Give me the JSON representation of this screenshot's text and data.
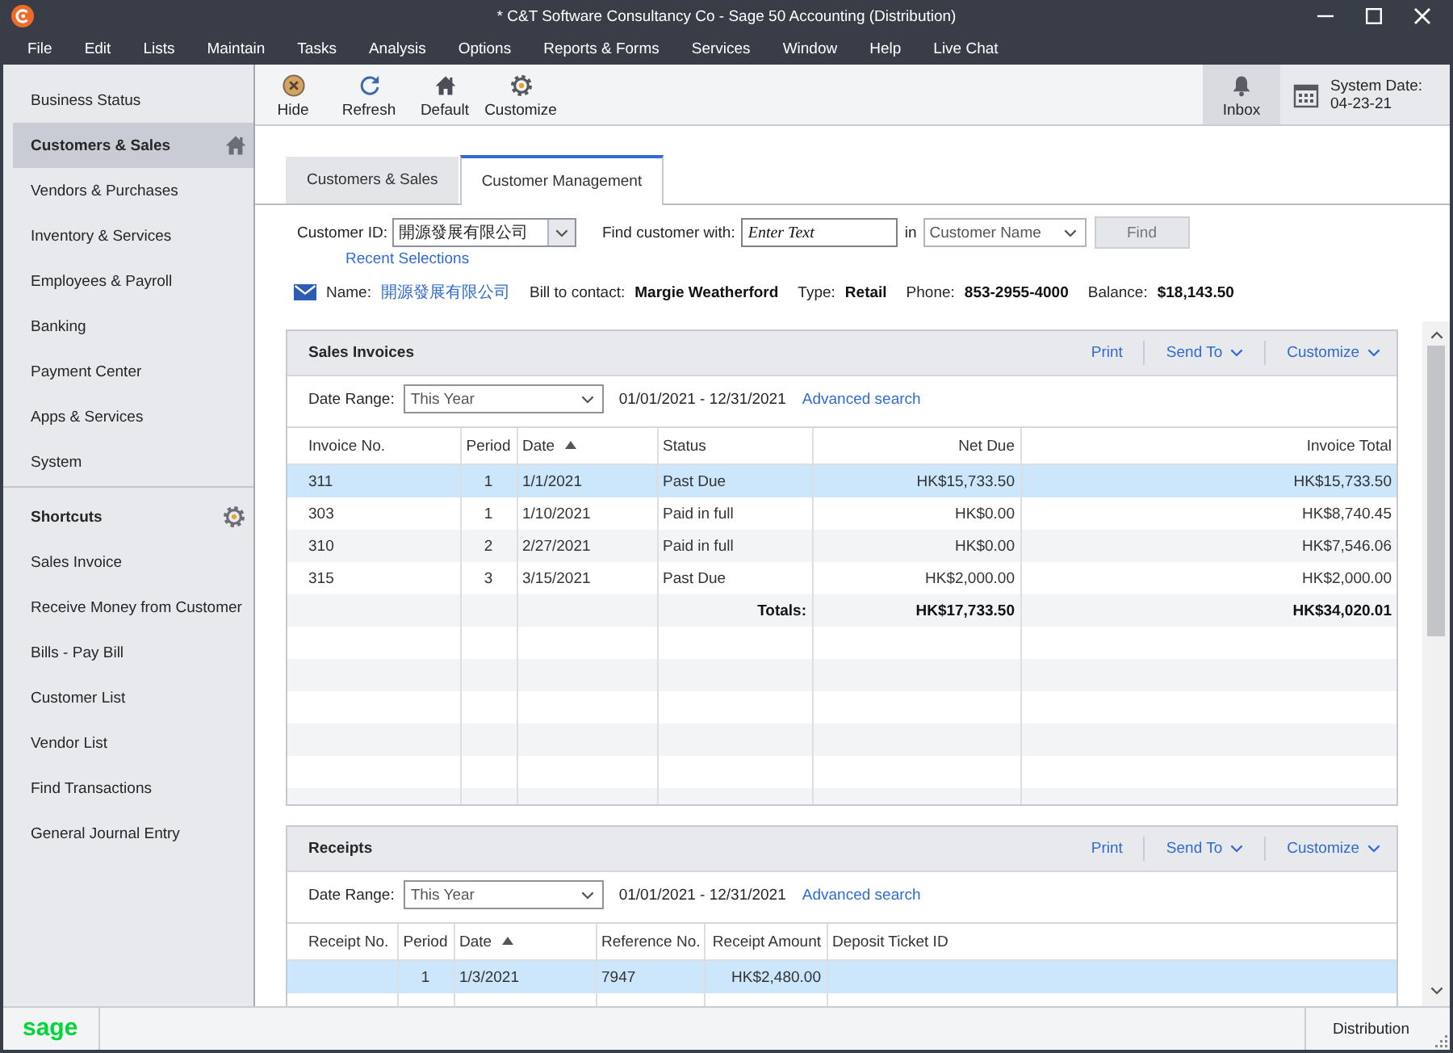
{
  "window": {
    "title": "* C&T Software Consultancy Co - Sage 50 Accounting (Distribution)"
  },
  "menu": [
    "File",
    "Edit",
    "Lists",
    "Maintain",
    "Tasks",
    "Analysis",
    "Options",
    "Reports & Forms",
    "Services",
    "Window",
    "Help",
    "Live Chat"
  ],
  "sidebar": {
    "nav": [
      {
        "label": "Business Status",
        "selected": false
      },
      {
        "label": "Customers & Sales",
        "selected": true
      },
      {
        "label": "Vendors & Purchases",
        "selected": false
      },
      {
        "label": "Inventory & Services",
        "selected": false
      },
      {
        "label": "Employees & Payroll",
        "selected": false
      },
      {
        "label": "Banking",
        "selected": false
      },
      {
        "label": "Payment Center",
        "selected": false
      },
      {
        "label": "Apps & Services",
        "selected": false
      },
      {
        "label": "System",
        "selected": false
      }
    ],
    "shortcuts_title": "Shortcuts",
    "shortcuts": [
      "Sales Invoice",
      "Receive Money from Customer",
      "Bills - Pay Bill",
      "Customer List",
      "Vendor List",
      "Find Transactions",
      "General Journal Entry"
    ]
  },
  "toolbar": {
    "buttons": [
      {
        "label": "Hide",
        "kind": "hide"
      },
      {
        "label": "Refresh",
        "kind": "refresh"
      },
      {
        "label": "Default",
        "kind": "default"
      },
      {
        "label": "Customize",
        "kind": "customize"
      }
    ],
    "inbox": "Inbox",
    "system_date_label": "System Date:",
    "system_date": "04-23-21"
  },
  "tabs": [
    {
      "label": "Customers & Sales",
      "selected": false
    },
    {
      "label": "Customer Management",
      "selected": true
    }
  ],
  "customer_search": {
    "id_label": "Customer ID:",
    "id_value": "開源發展有限公司",
    "recent_link": "Recent Selections",
    "find_label": "Find customer with:",
    "find_placeholder": "Enter Text",
    "in_label": "in",
    "field": "Customer Name",
    "find_button": {
      "label": "Find",
      "disabled": true
    }
  },
  "customer_info": [
    {
      "label": "Name:",
      "value": "開源發展有限公司",
      "kind": "link"
    },
    {
      "label": "Bill to contact:",
      "value": "Margie Weatherford",
      "kind": "bold"
    },
    {
      "label": "Type:",
      "value": "Retail",
      "kind": "bold"
    },
    {
      "label": "Phone:",
      "value": "853-2955-4000",
      "kind": "bold"
    },
    {
      "label": "Balance:",
      "value": "$18,143.50",
      "kind": "bold"
    }
  ],
  "sales_invoices": {
    "title": "Sales Invoices",
    "actions": [
      {
        "label": "Print",
        "dropdown": false
      },
      {
        "label": "Send To",
        "dropdown": true
      },
      {
        "label": "Customize",
        "dropdown": true
      }
    ],
    "date_range_label": "Date Range:",
    "date_range": "This Year",
    "date_span": "01/01/2021 - 12/31/2021",
    "advanced_link": "Advanced search",
    "columns": [
      {
        "label": "Invoice No.",
        "sorted": false
      },
      {
        "label": "Period",
        "sorted": false
      },
      {
        "label": "Date",
        "sorted": true
      },
      {
        "label": "Status",
        "sorted": false
      },
      {
        "label": "Net Due",
        "sorted": false
      },
      {
        "label": "Invoice Total",
        "sorted": false
      }
    ],
    "rows": [
      {
        "invoice_no": "311",
        "period": "1",
        "date": "1/1/2021",
        "status": "Past Due",
        "net_due": "HK$15,733.50",
        "invoice_total": "HK$15,733.50",
        "selected": true
      },
      {
        "invoice_no": "303",
        "period": "1",
        "date": "1/10/2021",
        "status": "Paid in full",
        "net_due": "HK$0.00",
        "invoice_total": "HK$8,740.45",
        "selected": false
      },
      {
        "invoice_no": "310",
        "period": "2",
        "date": "2/27/2021",
        "status": "Paid in full",
        "net_due": "HK$0.00",
        "invoice_total": "HK$7,546.06",
        "selected": false
      },
      {
        "invoice_no": "315",
        "period": "3",
        "date": "3/15/2021",
        "status": "Past Due",
        "net_due": "HK$2,000.00",
        "invoice_total": "HK$2,000.00",
        "selected": false
      }
    ],
    "totals": {
      "label": "Totals:",
      "net_due": "HK$17,733.50",
      "invoice_total": "HK$34,020.01"
    }
  },
  "receipts": {
    "title": "Receipts",
    "actions": [
      {
        "label": "Print",
        "dropdown": false
      },
      {
        "label": "Send To",
        "dropdown": true
      },
      {
        "label": "Customize",
        "dropdown": true
      }
    ],
    "date_range_label": "Date Range:",
    "date_range": "This Year",
    "date_span": "01/01/2021 - 12/31/2021",
    "advanced_link": "Advanced search",
    "columns": [
      {
        "label": "Receipt No.",
        "sorted": false
      },
      {
        "label": "Period",
        "sorted": false
      },
      {
        "label": "Date",
        "sorted": true
      },
      {
        "label": "Reference No.",
        "sorted": false
      },
      {
        "label": "Receipt Amount",
        "sorted": false
      },
      {
        "label": "Deposit Ticket ID",
        "sorted": false
      }
    ],
    "rows": [
      {
        "period": "1",
        "date": "1/3/2021",
        "reference_no": "7947",
        "receipt_amount": "HK$2,480.00",
        "selected": true
      }
    ]
  },
  "status_bar": {
    "logo": "sage",
    "edition": "Distribution"
  }
}
